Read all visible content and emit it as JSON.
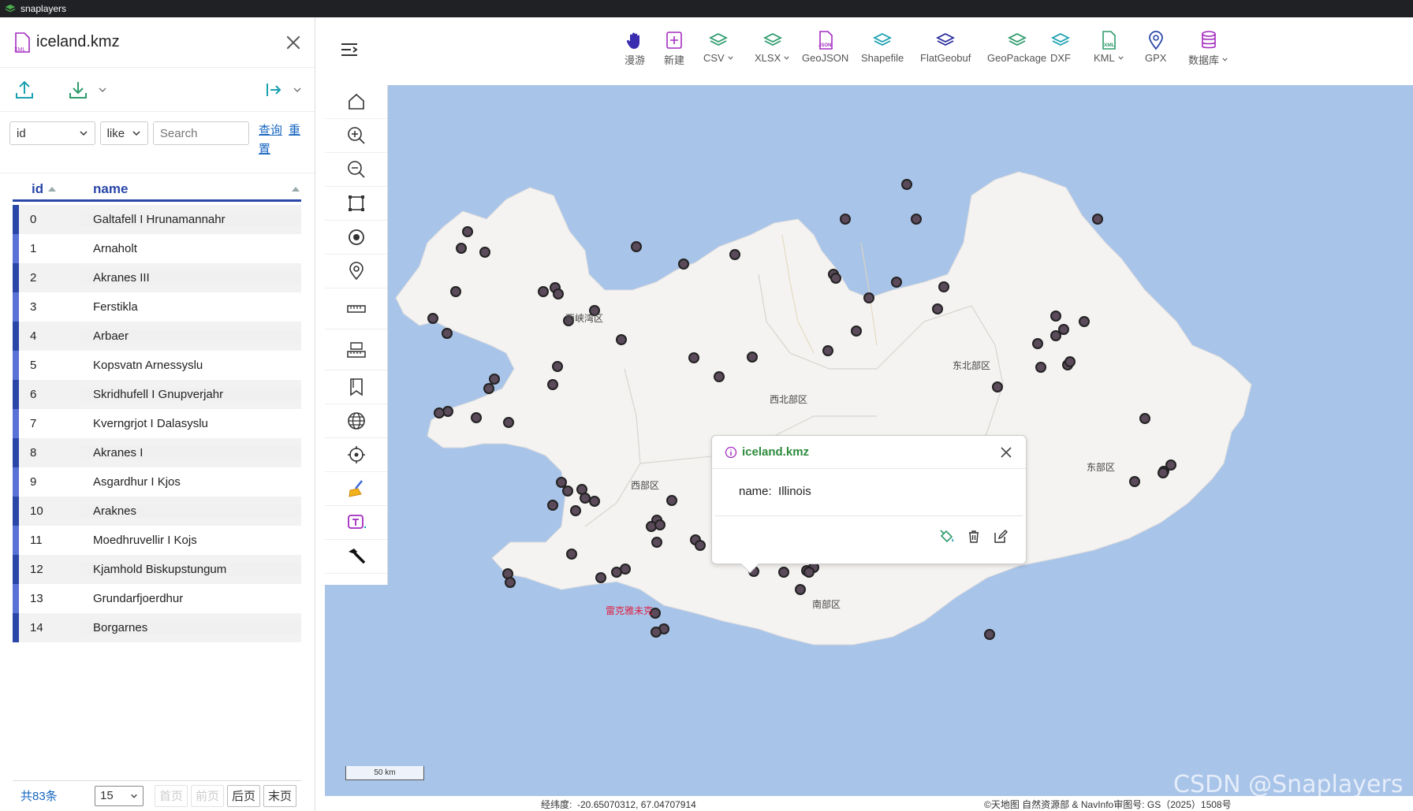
{
  "app": {
    "title": "snaplayers"
  },
  "file": {
    "name": "iceland.kmz"
  },
  "filter": {
    "field": "id",
    "op": "like",
    "search_placeholder": "Search",
    "query_label": "查询",
    "reset_label": "重置"
  },
  "table": {
    "columns": [
      "id",
      "name"
    ],
    "rows": [
      {
        "id": "0",
        "name": "Galtafell I Hrunamannahr"
      },
      {
        "id": "1",
        "name": "Arnaholt"
      },
      {
        "id": "2",
        "name": "Akranes III"
      },
      {
        "id": "3",
        "name": "Ferstikla"
      },
      {
        "id": "4",
        "name": "Arbaer"
      },
      {
        "id": "5",
        "name": "Kopsvatn Arnessyslu"
      },
      {
        "id": "6",
        "name": "Skridhufell I Gnupverjahr"
      },
      {
        "id": "7",
        "name": "Kverngrjot I Dalasyslu"
      },
      {
        "id": "8",
        "name": "Akranes I"
      },
      {
        "id": "9",
        "name": "Asgardhur I Kjos"
      },
      {
        "id": "10",
        "name": "Araknes"
      },
      {
        "id": "11",
        "name": "Moedhruvellir I Kojs"
      },
      {
        "id": "12",
        "name": "Kjamhold Biskupstungum"
      },
      {
        "id": "13",
        "name": "Grundarfjoerdhur"
      },
      {
        "id": "14",
        "name": "Borgarnes"
      }
    ]
  },
  "pager": {
    "total": "共83条",
    "page_size": "15",
    "first": "首页",
    "prev": "前页",
    "next": "后页",
    "last": "末页"
  },
  "toolbar": [
    {
      "label": "漫游",
      "color": "#3a2db0"
    },
    {
      "label": "新建",
      "color": "#a32bc0"
    },
    {
      "label": "CSV",
      "color": "#2e9b6c",
      "menu": true
    },
    {
      "label": "XLSX",
      "color": "#2e9b6c",
      "menu": true
    },
    {
      "label": "GeoJSON",
      "color": "#a32bc0"
    },
    {
      "label": "Shapefile",
      "color": "#1aa0b0"
    },
    {
      "label": "FlatGeobuf",
      "color": "#2a2d9b"
    },
    {
      "label": "GeoPackage",
      "color": "#2e9b6c"
    },
    {
      "label": "DXF",
      "color": "#1aa0b0"
    },
    {
      "label": "KML",
      "color": "#2e9b6c",
      "menu": true
    },
    {
      "label": "GPX",
      "color": "#2a47a8"
    },
    {
      "label": "数据库",
      "color": "#a32bc0",
      "menu": true
    }
  ],
  "regions": [
    "西峡湾区",
    "东北部区",
    "西北部区",
    "东部区",
    "西部区",
    "南部区",
    "雷克雅未克"
  ],
  "popup": {
    "title": "iceland.kmz",
    "field": "name:",
    "value": "Illinois"
  },
  "scale": "50 km",
  "coords": {
    "label": "经纬度:",
    "value": "-20.65070312, 67.04707914"
  },
  "attribution": "©天地图 自然资源部 & NavInfo审图号: GS（2025）1508号",
  "watermark": "CSDN @Snaplayers"
}
